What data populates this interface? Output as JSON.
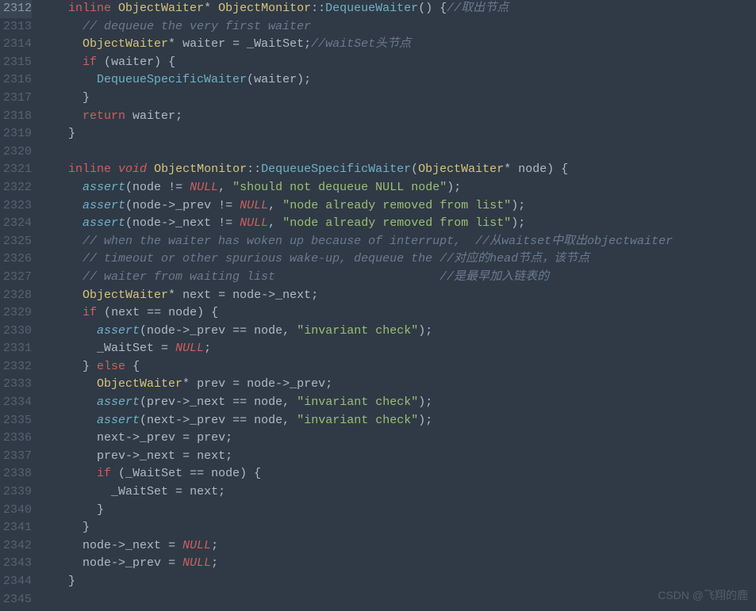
{
  "watermark": "CSDN @飞翔的鹿",
  "lines": [
    {
      "num": "2312",
      "ind": "  ",
      "tokens": [
        [
          "k-inline",
          "inline"
        ],
        [
          "",
          ""
        ],
        [
          "type",
          "ObjectWaiter"
        ],
        [
          "op",
          "*"
        ],
        [
          "",
          ""
        ],
        [
          "type",
          "ObjectMonitor"
        ],
        [
          "op",
          "::"
        ],
        [
          "fn-def",
          "DequeueWaiter"
        ],
        [
          "punct",
          "()"
        ],
        [
          "",
          ""
        ],
        [
          "punct",
          "{"
        ],
        [
          "comment",
          "//取出节点"
        ]
      ]
    },
    {
      "num": "2313",
      "ind": "    ",
      "tokens": [
        [
          "comment",
          "// dequeue the very first waiter"
        ]
      ]
    },
    {
      "num": "2314",
      "ind": "    ",
      "tokens": [
        [
          "type",
          "ObjectWaiter"
        ],
        [
          "op",
          "*"
        ],
        [
          "",
          ""
        ],
        [
          "id",
          "waiter"
        ],
        [
          "",
          ""
        ],
        [
          "op",
          "="
        ],
        [
          "",
          ""
        ],
        [
          "id",
          "_WaitSet"
        ],
        [
          "punct",
          ";"
        ],
        [
          "comment",
          "//waitSet头节点"
        ]
      ]
    },
    {
      "num": "2315",
      "ind": "    ",
      "tokens": [
        [
          "kw",
          "if"
        ],
        [
          "",
          ""
        ],
        [
          "punct",
          "("
        ],
        [
          "id",
          "waiter"
        ],
        [
          "punct",
          ")"
        ],
        [
          "",
          ""
        ],
        [
          "punct",
          "{"
        ]
      ]
    },
    {
      "num": "2316",
      "ind": "      ",
      "tokens": [
        [
          "call",
          "DequeueSpecificWaiter"
        ],
        [
          "punct",
          "("
        ],
        [
          "id",
          "waiter"
        ],
        [
          "punct",
          ")"
        ],
        [
          "punct",
          ";"
        ]
      ]
    },
    {
      "num": "2317",
      "ind": "    ",
      "tokens": [
        [
          "punct",
          "}"
        ]
      ]
    },
    {
      "num": "2318",
      "ind": "    ",
      "tokens": [
        [
          "kw",
          "return"
        ],
        [
          "",
          ""
        ],
        [
          "id",
          "waiter"
        ],
        [
          "punct",
          ";"
        ]
      ]
    },
    {
      "num": "2319",
      "ind": "  ",
      "tokens": [
        [
          "punct",
          "}"
        ]
      ]
    },
    {
      "num": "2320",
      "ind": "",
      "tokens": []
    },
    {
      "num": "2321",
      "ind": "  ",
      "tokens": [
        [
          "k-inline",
          "inline"
        ],
        [
          "",
          ""
        ],
        [
          "k-void",
          "void"
        ],
        [
          "",
          ""
        ],
        [
          "type",
          "ObjectMonitor"
        ],
        [
          "op",
          "::"
        ],
        [
          "fn-def",
          "DequeueSpecificWaiter"
        ],
        [
          "punct",
          "("
        ],
        [
          "type",
          "ObjectWaiter"
        ],
        [
          "op",
          "*"
        ],
        [
          "",
          ""
        ],
        [
          "id",
          "node"
        ],
        [
          "punct",
          ")"
        ],
        [
          "",
          ""
        ],
        [
          "punct",
          "{"
        ]
      ]
    },
    {
      "num": "2322",
      "ind": "    ",
      "tokens": [
        [
          "assert",
          "assert"
        ],
        [
          "punct",
          "("
        ],
        [
          "id",
          "node"
        ],
        [
          "",
          ""
        ],
        [
          "op",
          "!="
        ],
        [
          "",
          ""
        ],
        [
          "null",
          "NULL"
        ],
        [
          "punct",
          ","
        ],
        [
          "",
          ""
        ],
        [
          "str",
          "\"should not dequeue NULL node\""
        ],
        [
          "punct",
          ")"
        ],
        [
          "punct",
          ";"
        ]
      ]
    },
    {
      "num": "2323",
      "ind": "    ",
      "tokens": [
        [
          "assert",
          "assert"
        ],
        [
          "punct",
          "("
        ],
        [
          "id",
          "node"
        ],
        [
          "op",
          "->"
        ],
        [
          "id",
          "_prev"
        ],
        [
          "",
          ""
        ],
        [
          "op",
          "!="
        ],
        [
          "",
          ""
        ],
        [
          "null",
          "NULL"
        ],
        [
          "punct",
          ","
        ],
        [
          "",
          ""
        ],
        [
          "str",
          "\"node already removed from list\""
        ],
        [
          "punct",
          ")"
        ],
        [
          "punct",
          ";"
        ]
      ]
    },
    {
      "num": "2324",
      "ind": "    ",
      "tokens": [
        [
          "assert",
          "assert"
        ],
        [
          "punct",
          "("
        ],
        [
          "id",
          "node"
        ],
        [
          "op",
          "->"
        ],
        [
          "id",
          "_next"
        ],
        [
          "",
          ""
        ],
        [
          "op",
          "!="
        ],
        [
          "",
          ""
        ],
        [
          "null",
          "NULL"
        ],
        [
          "punct",
          ","
        ],
        [
          "",
          ""
        ],
        [
          "str",
          "\"node already removed from list\""
        ],
        [
          "punct",
          ")"
        ],
        [
          "punct",
          ";"
        ]
      ]
    },
    {
      "num": "2325",
      "ind": "    ",
      "tokens": [
        [
          "comment",
          "// when the waiter has woken up because of interrupt,  //从waitset中取出objectwaiter"
        ]
      ]
    },
    {
      "num": "2326",
      "ind": "    ",
      "tokens": [
        [
          "comment",
          "// timeout or other spurious wake-up, dequeue the //对应的head节点，该节点"
        ]
      ]
    },
    {
      "num": "2327",
      "ind": "    ",
      "tokens": [
        [
          "comment",
          "// waiter from waiting list                       //是最早加入链表的"
        ]
      ]
    },
    {
      "num": "2328",
      "ind": "    ",
      "tokens": [
        [
          "type",
          "ObjectWaiter"
        ],
        [
          "op",
          "*"
        ],
        [
          "",
          ""
        ],
        [
          "id",
          "next"
        ],
        [
          "",
          ""
        ],
        [
          "op",
          "="
        ],
        [
          "",
          ""
        ],
        [
          "id",
          "node"
        ],
        [
          "op",
          "->"
        ],
        [
          "id",
          "_next"
        ],
        [
          "punct",
          ";"
        ]
      ]
    },
    {
      "num": "2329",
      "ind": "    ",
      "tokens": [
        [
          "kw",
          "if"
        ],
        [
          "",
          ""
        ],
        [
          "punct",
          "("
        ],
        [
          "id",
          "next"
        ],
        [
          "",
          ""
        ],
        [
          "op",
          "=="
        ],
        [
          "",
          ""
        ],
        [
          "id",
          "node"
        ],
        [
          "punct",
          ")"
        ],
        [
          "",
          ""
        ],
        [
          "punct",
          "{"
        ]
      ]
    },
    {
      "num": "2330",
      "ind": "      ",
      "tokens": [
        [
          "assert",
          "assert"
        ],
        [
          "punct",
          "("
        ],
        [
          "id",
          "node"
        ],
        [
          "op",
          "->"
        ],
        [
          "id",
          "_prev"
        ],
        [
          "",
          ""
        ],
        [
          "op",
          "=="
        ],
        [
          "",
          ""
        ],
        [
          "id",
          "node"
        ],
        [
          "punct",
          ","
        ],
        [
          "",
          ""
        ],
        [
          "str",
          "\"invariant check\""
        ],
        [
          "punct",
          ")"
        ],
        [
          "punct",
          ";"
        ]
      ]
    },
    {
      "num": "2331",
      "ind": "      ",
      "tokens": [
        [
          "id",
          "_WaitSet"
        ],
        [
          "",
          ""
        ],
        [
          "op",
          "="
        ],
        [
          "",
          ""
        ],
        [
          "null",
          "NULL"
        ],
        [
          "punct",
          ";"
        ]
      ]
    },
    {
      "num": "2332",
      "ind": "    ",
      "tokens": [
        [
          "punct",
          "}"
        ],
        [
          "",
          ""
        ],
        [
          "kw",
          "else"
        ],
        [
          "",
          ""
        ],
        [
          "punct",
          "{"
        ]
      ]
    },
    {
      "num": "2333",
      "ind": "      ",
      "tokens": [
        [
          "type",
          "ObjectWaiter"
        ],
        [
          "op",
          "*"
        ],
        [
          "",
          ""
        ],
        [
          "id",
          "prev"
        ],
        [
          "",
          ""
        ],
        [
          "op",
          "="
        ],
        [
          "",
          ""
        ],
        [
          "id",
          "node"
        ],
        [
          "op",
          "->"
        ],
        [
          "id",
          "_prev"
        ],
        [
          "punct",
          ";"
        ]
      ]
    },
    {
      "num": "2334",
      "ind": "      ",
      "tokens": [
        [
          "assert",
          "assert"
        ],
        [
          "punct",
          "("
        ],
        [
          "id",
          "prev"
        ],
        [
          "op",
          "->"
        ],
        [
          "id",
          "_next"
        ],
        [
          "",
          ""
        ],
        [
          "op",
          "=="
        ],
        [
          "",
          ""
        ],
        [
          "id",
          "node"
        ],
        [
          "punct",
          ","
        ],
        [
          "",
          ""
        ],
        [
          "str",
          "\"invariant check\""
        ],
        [
          "punct",
          ")"
        ],
        [
          "punct",
          ";"
        ]
      ]
    },
    {
      "num": "2335",
      "ind": "      ",
      "tokens": [
        [
          "assert",
          "assert"
        ],
        [
          "punct",
          "("
        ],
        [
          "id",
          "next"
        ],
        [
          "op",
          "->"
        ],
        [
          "id",
          "_prev"
        ],
        [
          "",
          ""
        ],
        [
          "op",
          "=="
        ],
        [
          "",
          ""
        ],
        [
          "id",
          "node"
        ],
        [
          "punct",
          ","
        ],
        [
          "",
          ""
        ],
        [
          "str",
          "\"invariant check\""
        ],
        [
          "punct",
          ")"
        ],
        [
          "punct",
          ";"
        ]
      ]
    },
    {
      "num": "2336",
      "ind": "      ",
      "tokens": [
        [
          "id",
          "next"
        ],
        [
          "op",
          "->"
        ],
        [
          "id",
          "_prev"
        ],
        [
          "",
          ""
        ],
        [
          "op",
          "="
        ],
        [
          "",
          ""
        ],
        [
          "id",
          "prev"
        ],
        [
          "punct",
          ";"
        ]
      ]
    },
    {
      "num": "2337",
      "ind": "      ",
      "tokens": [
        [
          "id",
          "prev"
        ],
        [
          "op",
          "->"
        ],
        [
          "id",
          "_next"
        ],
        [
          "",
          ""
        ],
        [
          "op",
          "="
        ],
        [
          "",
          ""
        ],
        [
          "id",
          "next"
        ],
        [
          "punct",
          ";"
        ]
      ]
    },
    {
      "num": "2338",
      "ind": "      ",
      "tokens": [
        [
          "kw",
          "if"
        ],
        [
          "",
          ""
        ],
        [
          "punct",
          "("
        ],
        [
          "id",
          "_WaitSet"
        ],
        [
          "",
          ""
        ],
        [
          "op",
          "=="
        ],
        [
          "",
          ""
        ],
        [
          "id",
          "node"
        ],
        [
          "punct",
          ")"
        ],
        [
          "",
          ""
        ],
        [
          "punct",
          "{"
        ]
      ]
    },
    {
      "num": "2339",
      "ind": "        ",
      "tokens": [
        [
          "id",
          "_WaitSet"
        ],
        [
          "",
          ""
        ],
        [
          "op",
          "="
        ],
        [
          "",
          ""
        ],
        [
          "id",
          "next"
        ],
        [
          "punct",
          ";"
        ]
      ]
    },
    {
      "num": "2340",
      "ind": "      ",
      "tokens": [
        [
          "punct",
          "}"
        ]
      ]
    },
    {
      "num": "2341",
      "ind": "    ",
      "tokens": [
        [
          "punct",
          "}"
        ]
      ]
    },
    {
      "num": "2342",
      "ind": "    ",
      "tokens": [
        [
          "id",
          "node"
        ],
        [
          "op",
          "->"
        ],
        [
          "id",
          "_next"
        ],
        [
          "",
          ""
        ],
        [
          "op",
          "="
        ],
        [
          "",
          ""
        ],
        [
          "null",
          "NULL"
        ],
        [
          "punct",
          ";"
        ]
      ]
    },
    {
      "num": "2343",
      "ind": "    ",
      "tokens": [
        [
          "id",
          "node"
        ],
        [
          "op",
          "->"
        ],
        [
          "id",
          "_prev"
        ],
        [
          "",
          ""
        ],
        [
          "op",
          "="
        ],
        [
          "",
          ""
        ],
        [
          "null",
          "NULL"
        ],
        [
          "punct",
          ";"
        ]
      ]
    },
    {
      "num": "2344",
      "ind": "  ",
      "tokens": [
        [
          "punct",
          "}"
        ]
      ]
    },
    {
      "num": "2345",
      "ind": "",
      "tokens": []
    }
  ],
  "current_line_index": 0
}
